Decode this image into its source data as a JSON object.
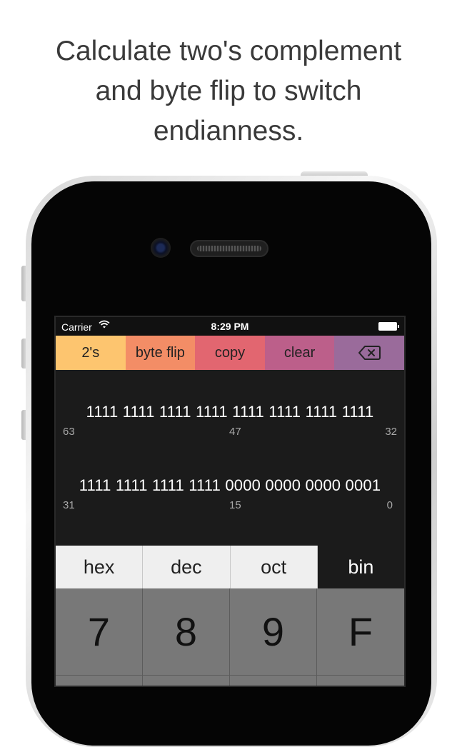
{
  "headline": [
    "Calculate two's complement",
    "and byte flip to switch",
    "endianness."
  ],
  "status_bar": {
    "carrier": "Carrier",
    "time": "8:29 PM"
  },
  "toolbar": [
    {
      "label": "2's",
      "color": "#fdc56f"
    },
    {
      "label": "byte flip",
      "color": "#f38d66"
    },
    {
      "label": "copy",
      "color": "#e26670"
    },
    {
      "label": "clear",
      "color": "#bc5f8a"
    },
    {
      "label": "",
      "icon": "backspace-icon",
      "color": "#9a6b9b"
    }
  ],
  "display": {
    "upper": {
      "bits": "1111 1111 1111 1111 1111 1111 1111 1111",
      "positions": [
        "63",
        "47",
        "32"
      ]
    },
    "lower": {
      "bits": "1111 1111 1111 1111 0000 0000 0000 0001",
      "positions": [
        "31",
        "15",
        "0"
      ]
    }
  },
  "modes": [
    "hex",
    "dec",
    "oct",
    "bin"
  ],
  "active_mode": "bin",
  "keys": [
    "7",
    "8",
    "9",
    "F",
    "",
    "",
    "",
    ""
  ]
}
